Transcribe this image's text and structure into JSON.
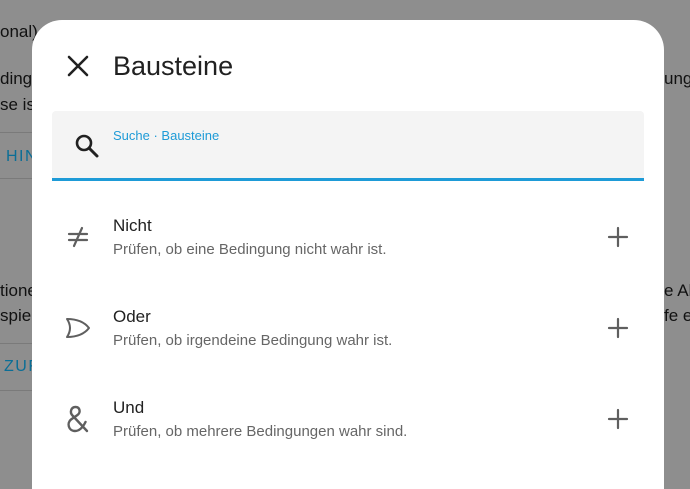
{
  "background": {
    "fragments": [
      {
        "text": "onal)",
        "style": "left:0;top:22px;"
      },
      {
        "text": "dingu",
        "style": "left:0;top:69px;"
      },
      {
        "text": "se ist",
        "style": "left:0;top:95px;"
      },
      {
        "text": "HIN",
        "style": "left:6px;top:148px;",
        "blue": true
      },
      {
        "text": "tione",
        "style": "left:0;top:281px;"
      },
      {
        "text": "spiel",
        "style": "left:0;top:306px;"
      },
      {
        "text": "ZUF",
        "style": "left:4px;top:358px;",
        "blue": true
      },
      {
        "text": "ung",
        "style": "left:664px;top:69px;"
      },
      {
        "text": "e Ak",
        "style": "left:664px;top:281px;"
      },
      {
        "text": "fe e",
        "style": "left:664px;top:306px;"
      }
    ]
  },
  "dialog": {
    "title": "Bausteine",
    "search": {
      "label": "Suche · Bausteine",
      "value": ""
    },
    "items": [
      {
        "title": "Nicht",
        "description": "Prüfen, ob eine Bedingung nicht wahr ist.",
        "icon": "not-equal-icon"
      },
      {
        "title": "Oder",
        "description": "Prüfen, ob irgendeine Bedingung wahr ist.",
        "icon": "or-gate-icon"
      },
      {
        "title": "Und",
        "description": "Prüfen, ob mehrere Bedingungen wahr sind.",
        "icon": "ampersand-icon"
      }
    ]
  },
  "colors": {
    "accent": "#1e9bd7",
    "overlay": "#8e8e8e",
    "icon": "#5f5f5f"
  }
}
